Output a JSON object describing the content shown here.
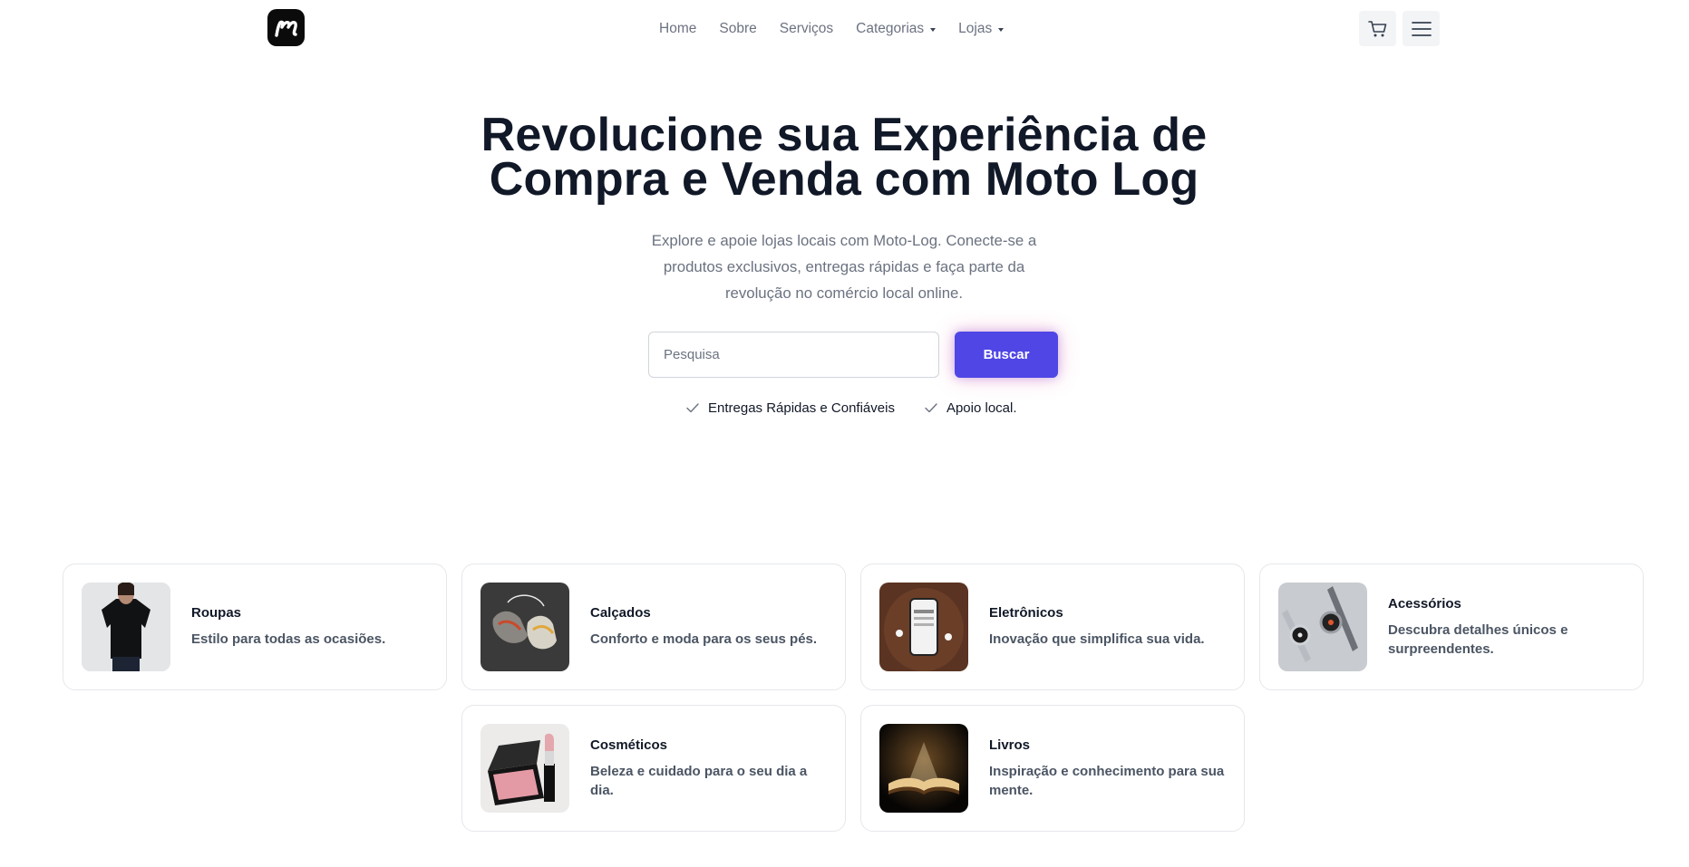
{
  "header": {
    "nav": [
      {
        "label": "Home",
        "dropdown": false
      },
      {
        "label": "Sobre",
        "dropdown": false
      },
      {
        "label": "Serviços",
        "dropdown": false
      },
      {
        "label": "Categorias",
        "dropdown": true
      },
      {
        "label": "Lojas",
        "dropdown": true
      }
    ],
    "icons": {
      "logo": "moto-log-logo",
      "cart": "cart-icon",
      "menu": "hamburger-menu-icon"
    }
  },
  "hero": {
    "title_lines": [
      "Revolucione sua Experiência de",
      "Compra e Venda com Moto Log"
    ],
    "subtitle_lines": [
      "Explore e apoie lojas locais com Moto-Log. Conecte-se a",
      "produtos exclusivos, entregas rápidas e faça parte da",
      "revolução no comércio local online."
    ]
  },
  "search": {
    "placeholder": "Pesquisa",
    "value": "",
    "button_label": "Buscar"
  },
  "features": [
    {
      "label": "Entregas Rápidas e Confiáveis",
      "icon": "check-icon"
    },
    {
      "label": "Apoio local.",
      "icon": "check-icon"
    }
  ],
  "categories": [
    {
      "title": "Roupas",
      "description": "Estilo para todas as ocasiões.",
      "image": "black-tshirt-photo"
    },
    {
      "title": "Calçados",
      "description": "Conforto e moda para os seus pés.",
      "image": "sneakers-photo"
    },
    {
      "title": "Eletrônicos",
      "description": "Inovação que simplifica sua vida.",
      "image": "smartphone-earbuds-photo"
    },
    {
      "title": "Acessórios",
      "description": "Descubra detalhes únicos e surpreendentes.",
      "image": "wristwatches-photo"
    },
    {
      "title": "Cosméticos",
      "description": "Beleza e cuidado para o seu dia a dia.",
      "image": "lipstick-blush-photo"
    },
    {
      "title": "Livros",
      "description": "Inspiração e conhecimento para sua mente.",
      "image": "open-book-photo"
    }
  ],
  "colors": {
    "accent": "#4f46e5",
    "text": "#111827",
    "muted": "#6b7280",
    "border": "#e5e7eb"
  }
}
